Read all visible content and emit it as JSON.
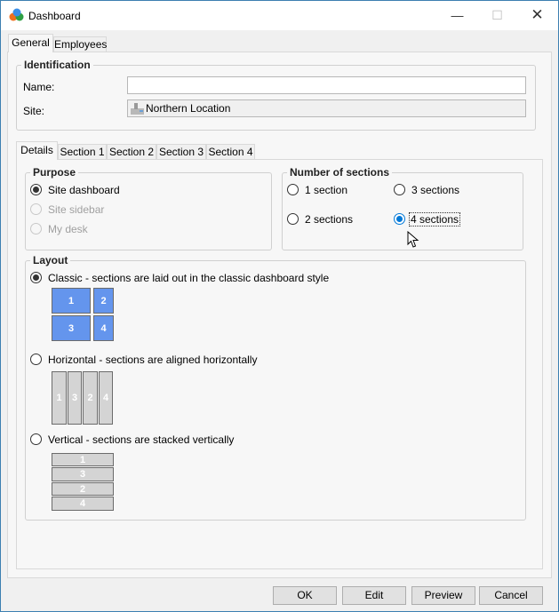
{
  "window": {
    "title": "Dashboard",
    "icon": "app-icon"
  },
  "outer_tabs": [
    {
      "label": "General",
      "active": true
    },
    {
      "label": "Employees",
      "active": false
    }
  ],
  "identification": {
    "heading": "Identification",
    "name_label": "Name:",
    "name_value": "",
    "site_label": "Site:",
    "site_value": "Northern Location"
  },
  "inner_tabs": [
    {
      "label": "Details",
      "active": true
    },
    {
      "label": "Section 1"
    },
    {
      "label": "Section 2"
    },
    {
      "label": "Section 3"
    },
    {
      "label": "Section 4"
    }
  ],
  "purpose": {
    "heading": "Purpose",
    "options": [
      {
        "label": "Site dashboard",
        "checked": true,
        "enabled": true
      },
      {
        "label": "Site sidebar",
        "checked": false,
        "enabled": false
      },
      {
        "label": "My desk",
        "checked": false,
        "enabled": false
      }
    ]
  },
  "sections": {
    "heading": "Number of sections",
    "options": [
      {
        "label": "1 section"
      },
      {
        "label": "3 sections"
      },
      {
        "label": "2 sections"
      },
      {
        "label": "4 sections",
        "checked": true
      }
    ]
  },
  "layout": {
    "heading": "Layout",
    "options": [
      {
        "label": "Classic - sections are laid out in the classic dashboard style",
        "checked": true,
        "tiles": [
          "1",
          "2",
          "3",
          "4"
        ]
      },
      {
        "label": "Horizontal - sections are aligned horizontally",
        "checked": false,
        "tiles": [
          "1",
          "3",
          "2",
          "4"
        ]
      },
      {
        "label": "Vertical - sections are stacked vertically",
        "checked": false,
        "tiles": [
          "1",
          "3",
          "2",
          "4"
        ]
      }
    ]
  },
  "buttons": {
    "ok": "OK",
    "edit": "Edit",
    "preview": "Preview",
    "cancel": "Cancel"
  },
  "colors": {
    "accent": "#0078d7",
    "tile_active": "#6495ed",
    "tile_inactive": "#d4d4d4"
  }
}
